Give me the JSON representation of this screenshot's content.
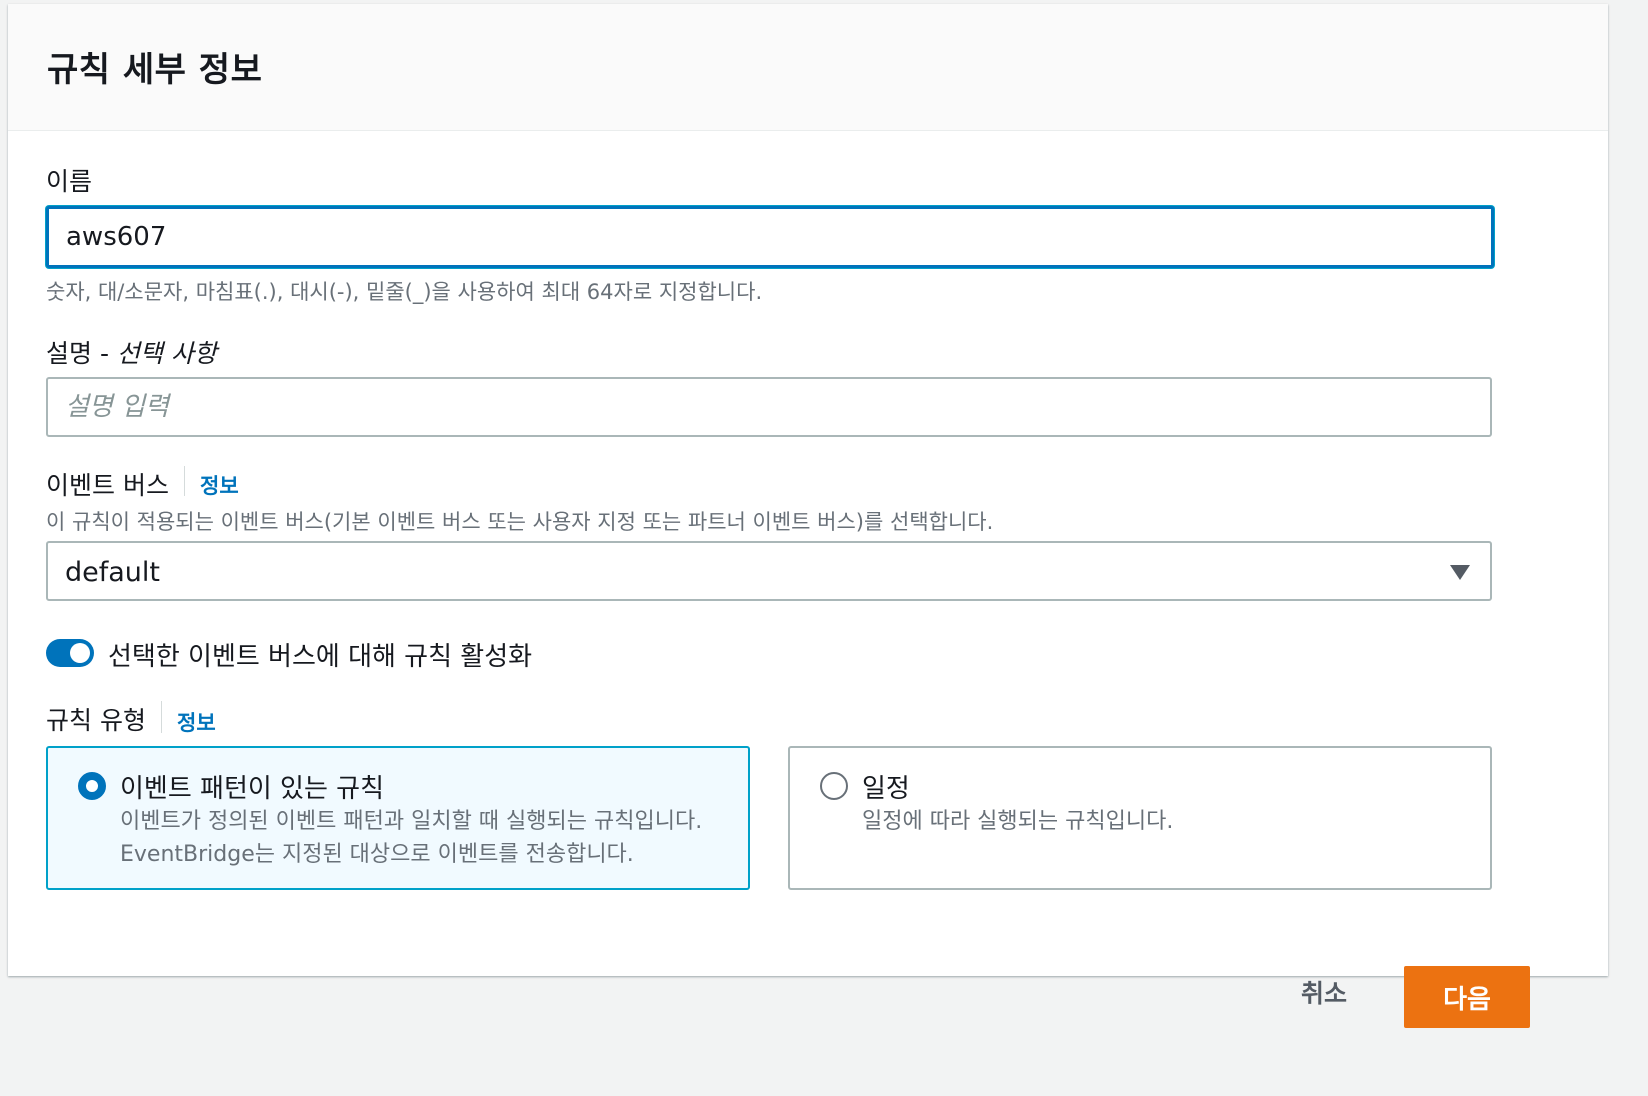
{
  "panel": {
    "title": "규칙 세부 정보"
  },
  "name_field": {
    "label": "이름",
    "value": "aws607",
    "hint": "숫자, 대/소문자, 마침표(.), 대시(-), 밑줄(_)을 사용하여 최대 64자로 지정합니다."
  },
  "description_field": {
    "label": "설명 - ",
    "label_optional": "선택 사항",
    "placeholder": "설명 입력"
  },
  "event_bus": {
    "label": "이벤트 버스",
    "info_link": "정보",
    "hint": "이 규칙이 적용되는 이벤트 버스(기본 이벤트 버스 또는 사용자 지정 또는 파트너 이벤트 버스)를 선택합니다.",
    "selected": "default"
  },
  "enable_toggle": {
    "label": "선택한 이벤트 버스에 대해 규칙 활성화",
    "checked": true
  },
  "rule_type": {
    "label": "규칙 유형",
    "info_link": "정보",
    "options": [
      {
        "title": "이벤트 패턴이 있는 규칙",
        "desc_line1": "이벤트가 정의된 이벤트 패턴과 일치할 때 실행되는 규칙입니다.",
        "desc_line2": "EventBridge는 지정된 대상으로 이벤트를 전송합니다.",
        "selected": true
      },
      {
        "title": "일정",
        "desc_line1": "일정에 따라 실행되는 규칙입니다.",
        "selected": false
      }
    ]
  },
  "footer": {
    "cancel_label": "취소",
    "next_label": "다음"
  },
  "colors": {
    "primary": "#0073bb",
    "accent_button": "#ec7211",
    "focus": "#00a1c9",
    "selected_tile_bg": "#f1faff"
  }
}
